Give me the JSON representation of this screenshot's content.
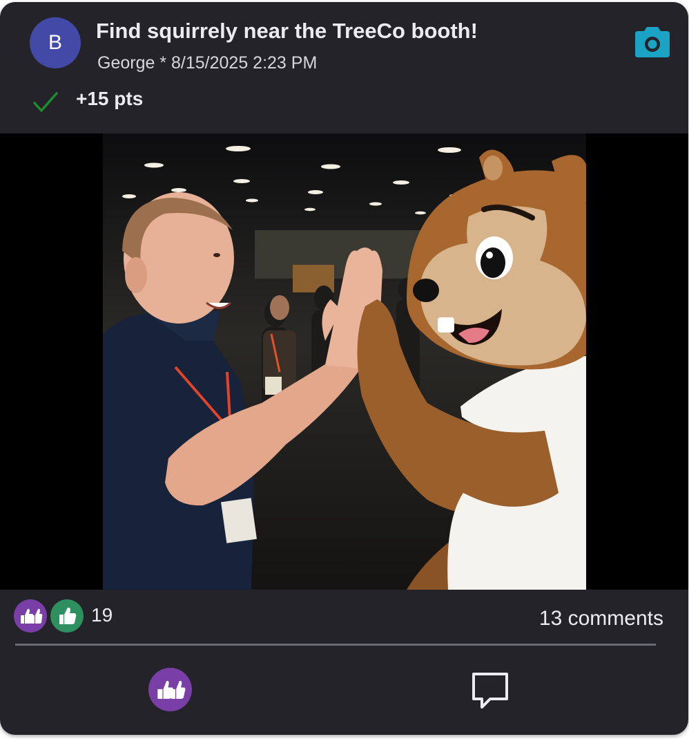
{
  "post": {
    "avatar_letter": "B",
    "title": "Find squirrely near the TreeCo booth!",
    "meta": "George * 8/15/2025 2:23 PM",
    "points": "+15 pts",
    "status_icon": "check-icon",
    "type_icon": "camera-icon"
  },
  "photo": {
    "description": "conference attendee high-fiving squirrel mascot"
  },
  "footer": {
    "reaction_icons": [
      "double-thumbs-up-icon",
      "thumbs-up-icon"
    ],
    "reaction_count": "19",
    "comments": "13 comments"
  },
  "colors": {
    "card_bg": "#232329",
    "avatar": "#4249a6",
    "accent_camera": "#1aa3c4",
    "check": "#1f8c2e",
    "reaction_purple": "#7a3fa6",
    "reaction_green": "#2e8f5f"
  }
}
